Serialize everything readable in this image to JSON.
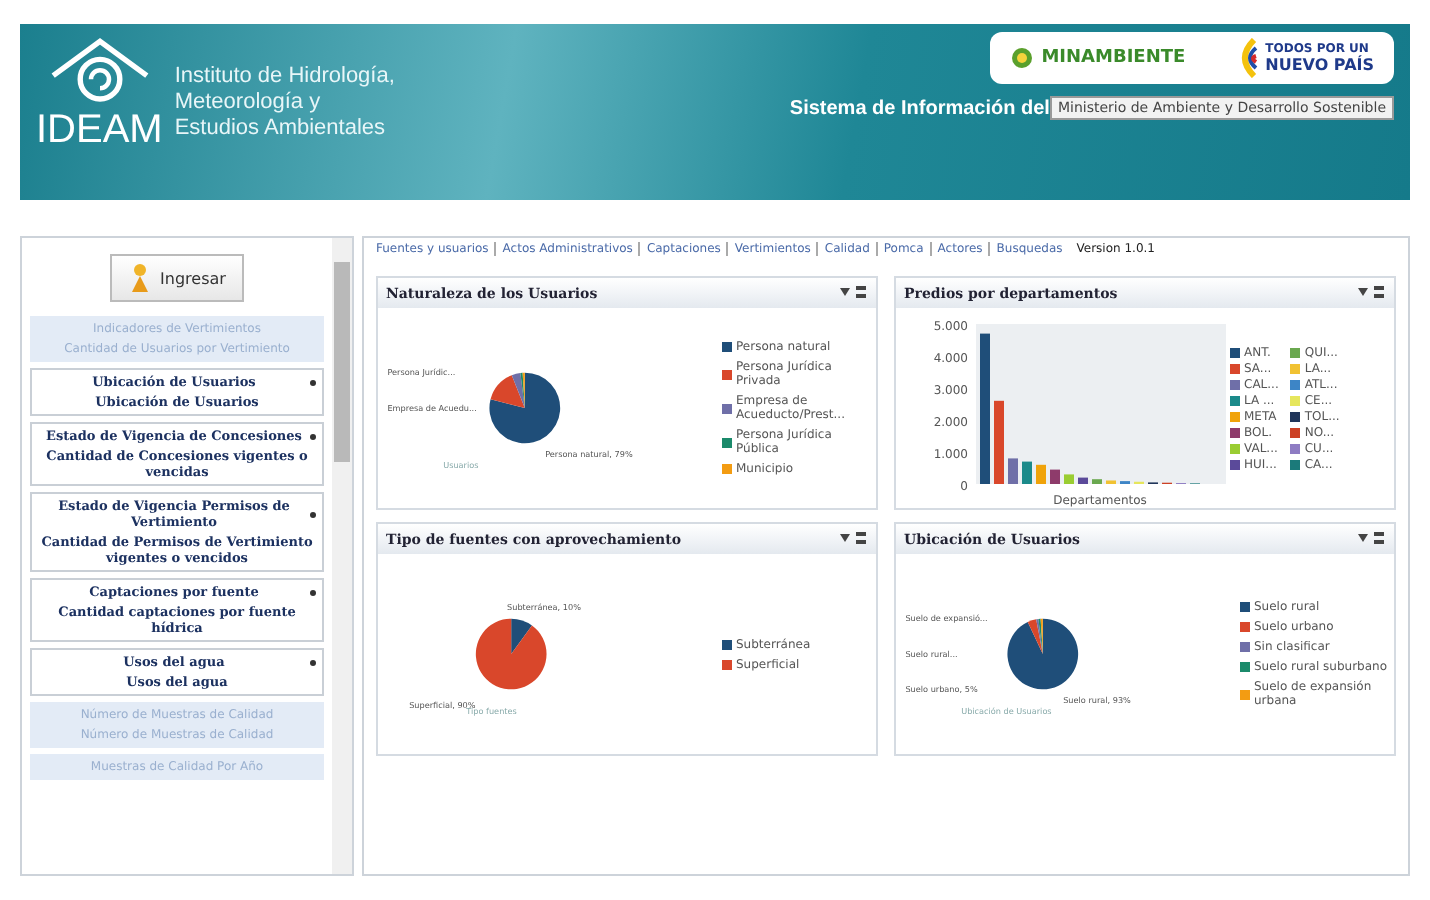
{
  "header": {
    "logo_text": "IDEAM",
    "institute": [
      "Instituto de Hidrología,",
      "Meteorología y",
      "Estudios Ambientales"
    ],
    "system_title": "Sistema de Información del",
    "tooltip": "Ministerio de Ambiente y Desarrollo Sostenible",
    "partner_logos": {
      "ministry": "MINAMBIENTE",
      "slogan": [
        "TODOS POR UN",
        "NUEVO PAÍS"
      ]
    }
  },
  "sidebar": {
    "login_button": "Ingresar",
    "items": [
      {
        "kind": "faded",
        "title": "Indicadores de Vertimientos",
        "link": "Cantidad de Usuarios por Vertimiento"
      },
      {
        "kind": "section",
        "title": "Ubicación de Usuarios",
        "link": "Ubicación de Usuarios"
      },
      {
        "kind": "section",
        "title": "Estado de Vigencia de Concesiones",
        "link": "Cantidad de Concesiones vigentes o vencidas"
      },
      {
        "kind": "section",
        "title": "Estado de Vigencia Permisos de Vertimiento",
        "link": "Cantidad de Permisos de Vertimiento vigentes o vencidos"
      },
      {
        "kind": "section",
        "title": "Captaciones por fuente",
        "link": "Cantidad captaciones por fuente hídrica"
      },
      {
        "kind": "section",
        "title": "Usos del agua",
        "link": "Usos del agua"
      },
      {
        "kind": "faded",
        "title": "Número de Muestras de Calidad",
        "link": "Número de Muestras de Calidad"
      },
      {
        "kind": "faded",
        "title": "Muestras de Calidad Por Año"
      }
    ]
  },
  "tabs": [
    "Fuentes y usuarios",
    "Actos Administrativos",
    "Captaciones",
    "Vertimientos",
    "Calidad",
    "Pomca",
    "Actores",
    "Busquedas"
  ],
  "version": "Version 1.0.1",
  "panels": [
    {
      "title": "Naturaleza de los Usuarios",
      "pie_labels": [
        "Persona Jurídic...",
        "Empresa de Acuedu...",
        "Persona natural, 79%"
      ],
      "chart_data": {
        "type": "pie",
        "title": "Usuarios",
        "legend": "right",
        "categories": [
          "Persona natural",
          "Persona Jurídica Privada",
          "Empresa de Acueducto/Prest...",
          "Persona Jurídica Pública",
          "Municipio"
        ],
        "series": [
          {
            "values": [
              79,
              15,
              4,
              1,
              1
            ],
            "colors": [
              "#1f4e79",
              "#d9472b",
              "#6f6fa8",
              "#1b8a6b",
              "#f39c12"
            ]
          }
        ]
      }
    },
    {
      "title": "Predios por departamentos",
      "chart_data": {
        "type": "bar",
        "legend": "right",
        "xlabel": "Departamentos",
        "ylim": [
          0,
          5000
        ],
        "yticks": [
          {
            "value": 0,
            "label": "0"
          },
          {
            "value": 1000,
            "label": "1.000"
          },
          {
            "value": 2000,
            "label": "2.000"
          },
          {
            "value": 3000,
            "label": "3.000"
          },
          {
            "value": 4000,
            "label": "4.000"
          },
          {
            "value": 5000,
            "label": "5.000"
          }
        ],
        "series": [
          {
            "name": "ANT.",
            "color": "#1f4e79",
            "values": [
              4700
            ]
          },
          {
            "name": "SA...",
            "color": "#d9472b",
            "values": [
              2600
            ]
          },
          {
            "name": "CAL...",
            "color": "#6f6fa8",
            "values": [
              800
            ]
          },
          {
            "name": "LA ...",
            "color": "#1b8a8a",
            "values": [
              700
            ]
          },
          {
            "name": "META",
            "color": "#f0a30a",
            "values": [
              600
            ]
          },
          {
            "name": "BOL.",
            "color": "#8e3b6b",
            "values": [
              450
            ]
          },
          {
            "name": "VAL...",
            "color": "#9acd32",
            "values": [
              300
            ]
          },
          {
            "name": "HUI...",
            "color": "#5b4a9a",
            "values": [
              200
            ]
          },
          {
            "name": "QUI...",
            "color": "#6aa84f",
            "values": [
              150
            ]
          },
          {
            "name": "LA...",
            "color": "#f1c232",
            "values": [
              110
            ]
          },
          {
            "name": "ATL...",
            "color": "#3d85c6",
            "values": [
              90
            ]
          },
          {
            "name": "CE...",
            "color": "#e6e65c",
            "values": [
              70
            ]
          },
          {
            "name": "TOL...",
            "color": "#20355a",
            "values": [
              50
            ]
          },
          {
            "name": "NO...",
            "color": "#cc4125",
            "values": [
              40
            ]
          },
          {
            "name": "CU...",
            "color": "#8e7cc3",
            "values": [
              30
            ]
          },
          {
            "name": "CA...",
            "color": "#1b7a7a",
            "values": [
              20
            ]
          }
        ]
      }
    },
    {
      "title": "Tipo de fuentes con aprovechamiento",
      "pie_labels": [
        "Subterránea, 10%",
        "Superficial, 90%"
      ],
      "chart_data": {
        "type": "pie",
        "title": "Tipo fuentes",
        "legend": "right",
        "categories": [
          "Subterránea",
          "Superficial"
        ],
        "series": [
          {
            "values": [
              10,
              90
            ],
            "colors": [
              "#1f4e79",
              "#d9472b"
            ]
          }
        ]
      }
    },
    {
      "title": "Ubicación de Usuarios",
      "pie_labels": [
        "Suelo de expansió...",
        "Suelo rural...",
        "Suelo urbano, 5%",
        "Suelo rural, 93%"
      ],
      "chart_data": {
        "type": "pie",
        "title": "Ubicación de Usuarios",
        "legend": "right",
        "categories": [
          "Suelo rural",
          "Suelo urbano",
          "Sin clasificar",
          "Suelo rural suburbano",
          "Suelo de expansión urbana"
        ],
        "series": [
          {
            "values": [
              93,
              4,
              1,
              1,
              1
            ],
            "colors": [
              "#1f4e79",
              "#d9472b",
              "#6f6fa8",
              "#1b8a6b",
              "#f39c12"
            ]
          }
        ]
      }
    }
  ]
}
